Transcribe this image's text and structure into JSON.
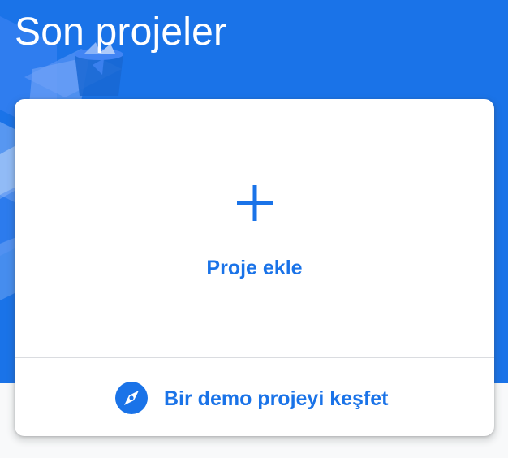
{
  "header": {
    "title": "Son projeler"
  },
  "card": {
    "add_project_label": "Proje ekle",
    "demo_project_label": "Bir demo projeyi keşfet"
  },
  "icons": {
    "add": "plus-icon",
    "demo": "compass-icon"
  },
  "colors": {
    "header_background": "#1a73e8",
    "accent": "#1a73e8",
    "page_background": "#f8f9fa",
    "card_background": "#ffffff",
    "divider": "#dadce0",
    "title_text": "#ffffff"
  }
}
